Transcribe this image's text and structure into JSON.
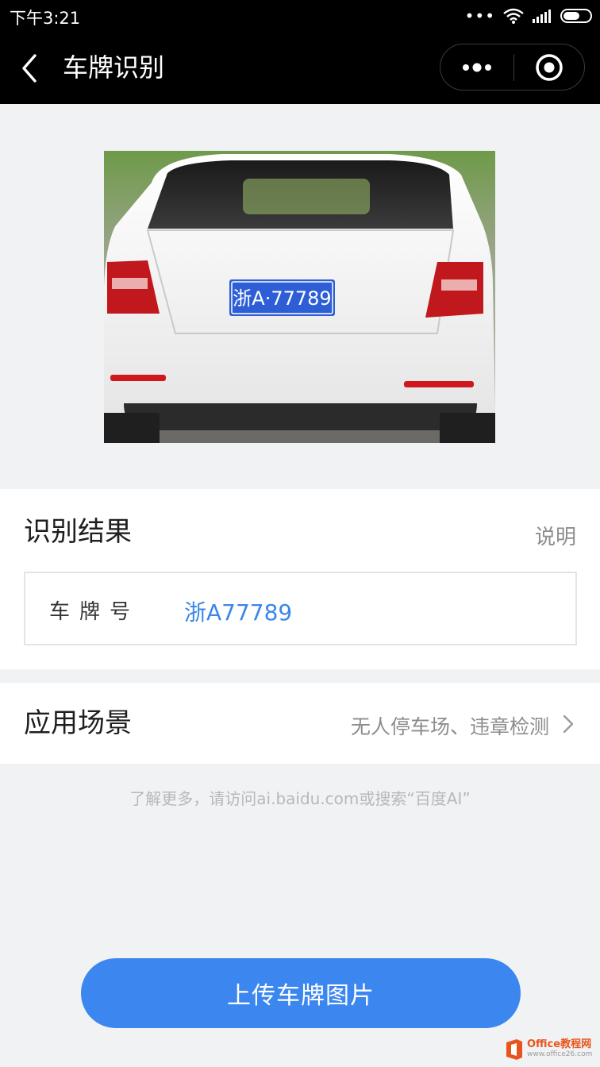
{
  "status_bar": {
    "time": "下午3:21",
    "dots": "•••"
  },
  "nav": {
    "title": "车牌识别"
  },
  "photo": {
    "plate_text": "浙A·77789",
    "plate_color": "#2d5ed6"
  },
  "result": {
    "title": "识别结果",
    "explain_label": "说明",
    "plate_label": "车牌号",
    "plate_value": "浙A77789"
  },
  "scenario": {
    "title": "应用场景",
    "value": "无人停车场、违章检测"
  },
  "hint": "了解更多，请访问ai.baidu.com或搜索“百度AI”",
  "upload_button": "上传车牌图片",
  "watermark": {
    "main": "Office教程网",
    "sub": "www.office26.com"
  },
  "colors": {
    "accent": "#3b86ef",
    "link": "#3b86e8",
    "nav_bg": "#000000",
    "page_bg": "#f1f2f4"
  }
}
